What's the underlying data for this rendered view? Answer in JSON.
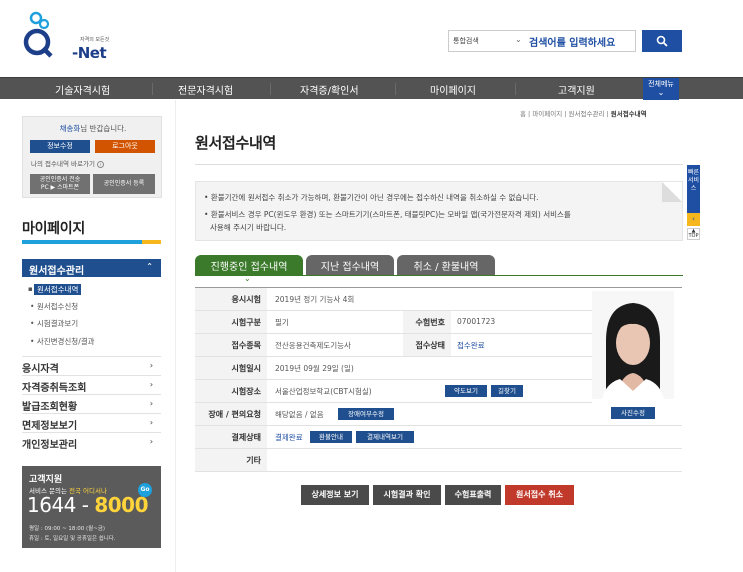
{
  "header": {
    "logo_tag": "자격의 모든것",
    "logo_text": "-Net",
    "search_select": "통합검색",
    "search_placeholder": "검색어를 입력하세요"
  },
  "gnb": {
    "items": [
      "기술자격시험",
      "전문자격시험",
      "자격증/확인서",
      "마이페이지",
      "고객지원"
    ],
    "all_menu": "전체메뉴"
  },
  "breadcrumb": {
    "items": [
      "홈",
      "마이페이지",
      "원서접수관리"
    ],
    "current": "원서접수내역"
  },
  "login": {
    "user_name": "채송화",
    "greeting_suffix": "님 반갑습니다.",
    "edit_info": "정보수정",
    "logout": "로그아웃",
    "shortcut": "나의 접수내역 바로가기",
    "cert_transfer_line1": "공인인증서 전송",
    "cert_transfer_line2": "PC ▶ 스마트폰",
    "cert_register": "공인인증서 등록"
  },
  "sidebar": {
    "title": "마이페이지",
    "section_head": "원서접수관리",
    "sub_items": [
      "원서접수내역",
      "원서접수신청",
      "시험결과보기",
      "사진변경신청/결과"
    ],
    "menu_items": [
      "응시자격",
      "자격증취득조회",
      "발급조회현황",
      "면제정보보기",
      "개인정보관리"
    ]
  },
  "customer_service": {
    "title": "고객지원",
    "desc_prefix": "서비스 문의는",
    "desc_highlight": "전국 어디서나",
    "go_label": "Go",
    "phone_prefix": "1644 -",
    "phone_suffix": "8000",
    "hours_line1": "평일 : 09:00 ~ 18:00 (월~금)",
    "hours_line2": "휴일 : 토, 일요일 및 공휴일은 쉽니다."
  },
  "main": {
    "title": "원서접수내역",
    "notices": [
      "• 환불기간에 원서접수 취소가 가능하며, 환불기간이 아닌 경우에는 접수하신 내역을 취소하실 수 없습니다.",
      "• 환불서비스 경우 PC(윈도우 환경) 또는 스마트기기(스마트폰, 태블릿PC)는 모바일 앱(국가전문자격 제외) 서비스를",
      "사용해 주시기 바랍니다."
    ],
    "quick_label": "빠른서비스",
    "top_label": "TOP",
    "tabs": [
      "진행중인 접수내역",
      "지난 접수내역",
      "취소 / 환불내역"
    ]
  },
  "exam": {
    "labels": {
      "exam": "응시시험",
      "type": "시험구분",
      "reg_no": "수험번호",
      "field": "접수종목",
      "status": "접수상태",
      "date": "시험일시",
      "place": "시험장소",
      "disability": "장애 / 편의요청",
      "payment": "결제상태",
      "etc": "기타"
    },
    "values": {
      "exam": "2019년 정기 기능사 4회",
      "type": "필기",
      "reg_no": "07001723",
      "field": "전산응용건축제도기능사",
      "status": "접수완료",
      "date": "2019년 09월 29일 (일)",
      "place": "서울산업정보학교(CBT시험실)",
      "disability": "해당없음 / 없음",
      "payment": "결제완료",
      "etc": ""
    },
    "buttons": {
      "map": "약도보기",
      "route": "길찾기",
      "disability_edit": "장애여부수정",
      "refund_info": "환불안내",
      "payment_detail": "결제내역보기",
      "photo_edit": "사진수정"
    }
  },
  "actions": [
    "상세정보 보기",
    "시험결과 확인",
    "수험표출력",
    "원서접수 취소"
  ],
  "colors": {
    "brand_blue": "#1f4fa3",
    "nav_gray": "#535353",
    "tab_green": "#3a7a2a",
    "cancel_red": "#c0392b"
  }
}
